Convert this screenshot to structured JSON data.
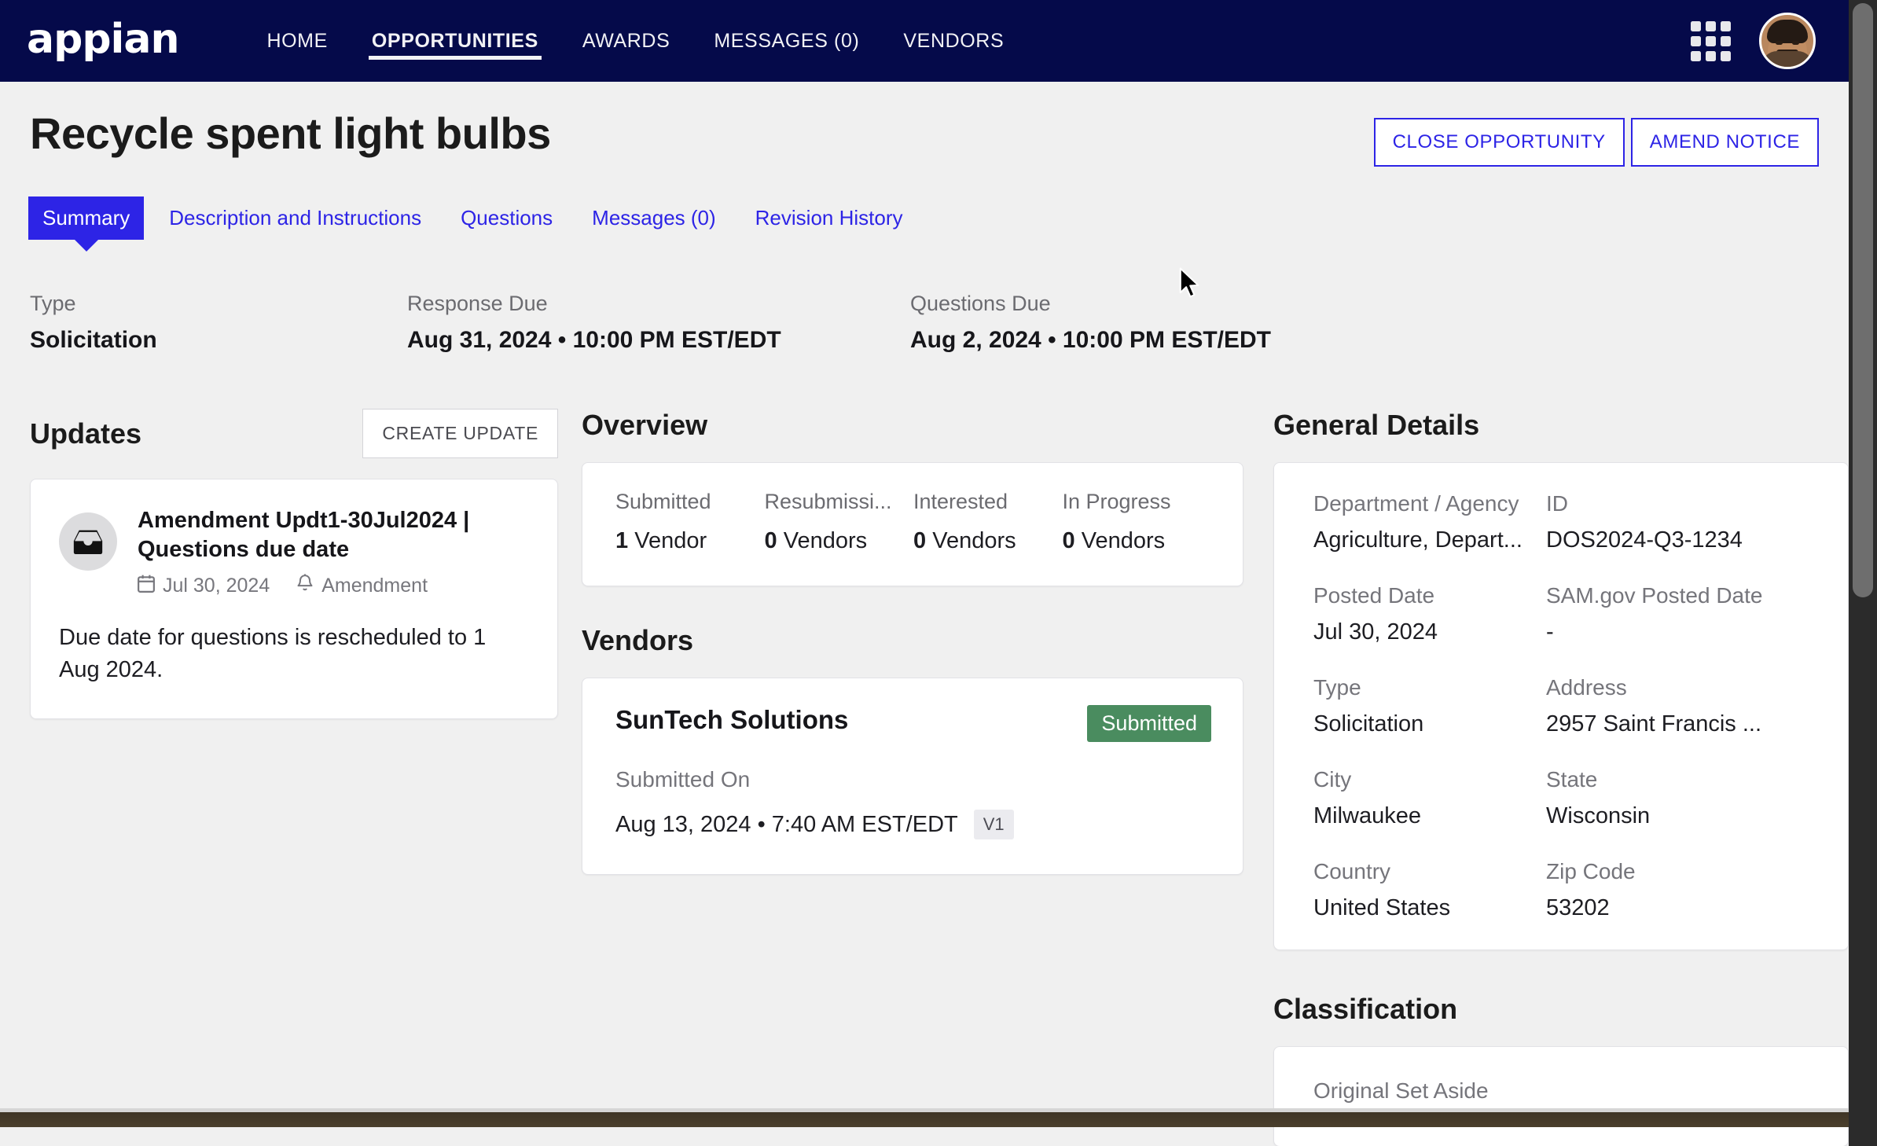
{
  "nav": {
    "logo": "appian",
    "links": [
      {
        "label": "HOME",
        "active": false
      },
      {
        "label": "OPPORTUNITIES",
        "active": true
      },
      {
        "label": "AWARDS",
        "active": false
      },
      {
        "label": "MESSAGES (0)",
        "active": false
      },
      {
        "label": "VENDORS",
        "active": false
      }
    ],
    "apps_icon": "grid-apps-icon",
    "avatar_alt": "user-avatar",
    "background_color": "#050a4a"
  },
  "header": {
    "title": "Recycle spent light bulbs",
    "actions": [
      {
        "label": "CLOSE OPPORTUNITY"
      },
      {
        "label": "AMEND NOTICE"
      }
    ],
    "accent_color": "#2d24e6"
  },
  "tabs": [
    {
      "label": "Summary",
      "active": true
    },
    {
      "label": "Description and Instructions",
      "active": false
    },
    {
      "label": "Questions",
      "active": false
    },
    {
      "label": "Messages (0)",
      "active": false
    },
    {
      "label": "Revision History",
      "active": false
    }
  ],
  "meta": [
    {
      "label": "Type",
      "value": "Solicitation"
    },
    {
      "label": "Response Due",
      "value": "Aug 31, 2024 • 10:00 PM EST/EDT"
    },
    {
      "label": "Questions Due",
      "value": "Aug 2, 2024 • 10:00 PM EST/EDT"
    }
  ],
  "updates": {
    "section_title": "Updates",
    "create_button": "CREATE UPDATE",
    "items": [
      {
        "icon": "inbox-icon",
        "title": "Amendment Updt1-30Jul2024 | Questions due date",
        "date_icon": "calendar-icon",
        "date": "Jul 30, 2024",
        "type_icon": "bell-icon",
        "type": "Amendment",
        "body": "Due date for questions is rescheduled to 1 Aug 2024."
      }
    ]
  },
  "overview": {
    "section_title": "Overview",
    "stats": [
      {
        "label": "Submitted",
        "count": "1",
        "unit": "Vendor"
      },
      {
        "label": "Resubmissi...",
        "count": "0",
        "unit": "Vendors"
      },
      {
        "label": "Interested",
        "count": "0",
        "unit": "Vendors"
      },
      {
        "label": "In Progress",
        "count": "0",
        "unit": "Vendors"
      }
    ]
  },
  "vendors": {
    "section_title": "Vendors",
    "items": [
      {
        "name": "SunTech Solutions",
        "status": "Submitted",
        "status_color": "#4a8c5f",
        "submitted_label": "Submitted On",
        "submitted_on": "Aug 13, 2024 • 7:40 AM EST/EDT",
        "version": "V1"
      }
    ]
  },
  "general_details": {
    "section_title": "General Details",
    "fields": [
      {
        "label": "Department / Agency",
        "value": "Agriculture, Depart..."
      },
      {
        "label": "ID",
        "value": "DOS2024-Q3-1234"
      },
      {
        "label": "Posted Date",
        "value": "Jul 30, 2024"
      },
      {
        "label": "SAM.gov Posted Date",
        "value": "-"
      },
      {
        "label": "Type",
        "value": "Solicitation"
      },
      {
        "label": "Address",
        "value": "2957 Saint Francis ..."
      },
      {
        "label": "City",
        "value": "Milwaukee"
      },
      {
        "label": "State",
        "value": "Wisconsin"
      },
      {
        "label": "Country",
        "value": "United States"
      },
      {
        "label": "Zip Code",
        "value": "53202"
      }
    ]
  },
  "classification": {
    "section_title": "Classification",
    "fields": [
      {
        "label": "Original Set Aside"
      }
    ]
  }
}
